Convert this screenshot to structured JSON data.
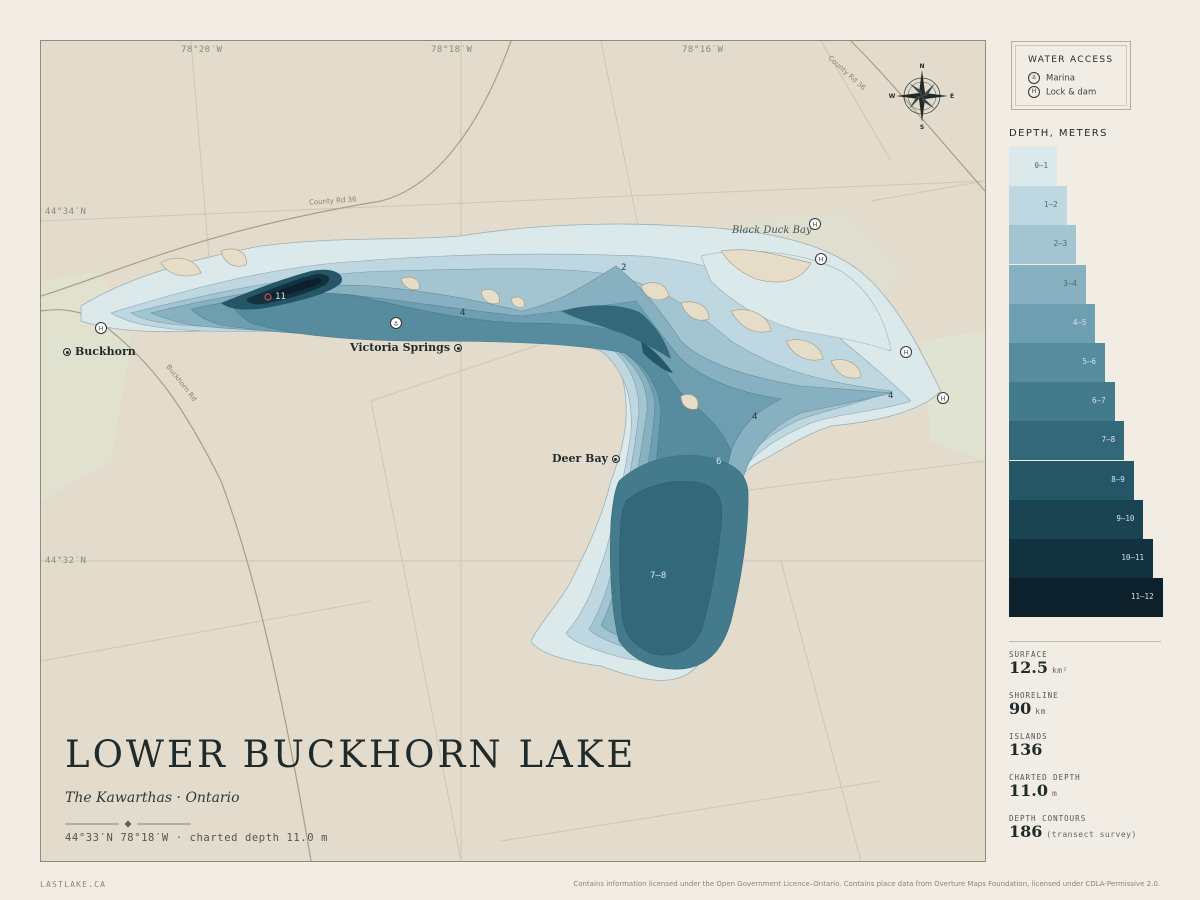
{
  "map": {
    "title": "LOWER BUCKHORN LAKE",
    "subtitle": "The Kawarthas · Ontario",
    "coords_line": "44°33′N 78°18′W · charted depth 11.0 m",
    "lon_labels": [
      "78°20′W",
      "78°18′W",
      "78°16′W"
    ],
    "lat_labels": [
      "44°34′N",
      "44°32′N"
    ],
    "places": {
      "buckhorn": "Buckhorn",
      "victoria_springs": "Victoria Springs",
      "deer_bay": "Deer Bay",
      "black_duck_bay": "Black Duck Bay"
    },
    "roads": {
      "county_36_north": "County Rd 36",
      "county_36_mid": "County Rd 36",
      "buckhorn_rd": "Buckhorn Rd"
    },
    "depth_labels": [
      "2",
      "4",
      "4",
      "4",
      "6",
      "7–8",
      "11"
    ],
    "compass": {
      "n": "N",
      "s": "S",
      "e": "E",
      "w": "W"
    }
  },
  "legend": {
    "title": "WATER ACCESS",
    "items": [
      {
        "icon": "anchor-icon",
        "label": "Marina"
      },
      {
        "icon": "lock-dam-icon",
        "label": "Lock & dam"
      }
    ]
  },
  "depth_scale": {
    "title": "DEPTH, METERS",
    "classes": [
      {
        "label": "0–1",
        "color": "#dce9ea"
      },
      {
        "label": "1–2",
        "color": "#bed7e0"
      },
      {
        "label": "2–3",
        "color": "#a3c5d2"
      },
      {
        "label": "3–4",
        "color": "#87b1c0"
      },
      {
        "label": "4–5",
        "color": "#6e9fb0"
      },
      {
        "label": "5–6",
        "color": "#578c9e"
      },
      {
        "label": "6–7",
        "color": "#437a8c"
      },
      {
        "label": "7–8",
        "color": "#33687a"
      },
      {
        "label": "8–9",
        "color": "#255666"
      },
      {
        "label": "9–10",
        "color": "#1a4452"
      },
      {
        "label": "10–11",
        "color": "#123240"
      },
      {
        "label": "11–12",
        "color": "#0c212c"
      }
    ]
  },
  "stats": [
    {
      "label": "SURFACE",
      "value": "12.5",
      "unit": "km²"
    },
    {
      "label": "SHORELINE",
      "value": "90",
      "unit": "km"
    },
    {
      "label": "ISLANDS",
      "value": "136",
      "unit": ""
    },
    {
      "label": "CHARTED DEPTH",
      "value": "11.0",
      "unit": "m"
    },
    {
      "label": "DEPTH CONTOURS",
      "value": "186",
      "unit": "(transect survey)"
    }
  ],
  "footer": {
    "site": "LASTLAKE.CA",
    "attribution": "Contains information licensed under the Open Government Licence–Ontario. Contains place data from Overture Maps Foundation, licensed under CDLA-Permissive 2.0."
  }
}
